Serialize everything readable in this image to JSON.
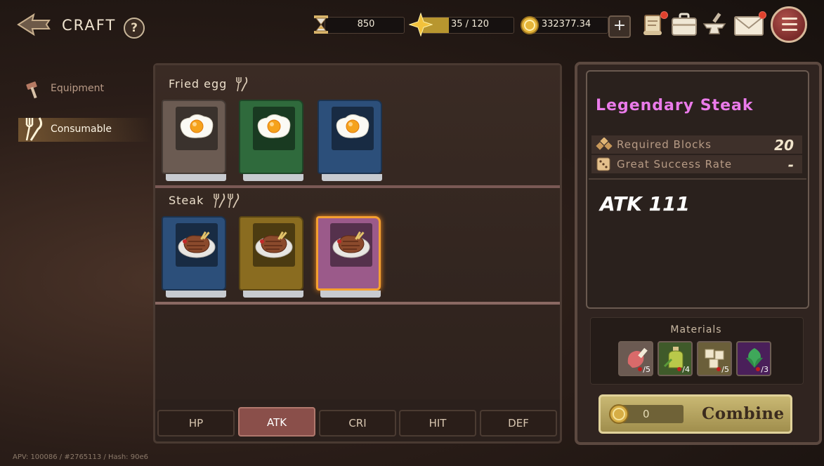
{
  "header": {
    "title": "CRAFT",
    "help_label": "?",
    "hourglass_value": "850",
    "energy_value": "35 / 120",
    "energy_fill": 0.29,
    "gold_value": "332377.34",
    "plus_label": "+"
  },
  "nav": {
    "items": [
      {
        "label": "Equipment",
        "icon": "hammer-icon",
        "active": false
      },
      {
        "label": "Consumable",
        "icon": "fork-knife-icon",
        "active": true
      }
    ]
  },
  "recipes": {
    "sections": [
      {
        "title": "Fried egg",
        "items": [
          {
            "name": "fried-egg",
            "rarity": "common",
            "cover": "#6b5b52"
          },
          {
            "name": "fried-egg",
            "rarity": "uncommon",
            "cover": "#2f6a3c"
          },
          {
            "name": "fried-egg",
            "rarity": "rare",
            "cover": "#2c4f7a"
          }
        ]
      },
      {
        "title": "Steak",
        "items": [
          {
            "name": "steak",
            "rarity": "rare",
            "cover": "#2c4f7a"
          },
          {
            "name": "steak",
            "rarity": "epic",
            "cover": "#8a6c20"
          },
          {
            "name": "steak",
            "rarity": "legendary",
            "cover": "#9b5a8a",
            "selected": true
          }
        ]
      }
    ]
  },
  "tabs": [
    {
      "label": "HP",
      "active": false
    },
    {
      "label": "ATK",
      "active": true
    },
    {
      "label": "CRI",
      "active": false
    },
    {
      "label": "HIT",
      "active": false
    },
    {
      "label": "DEF",
      "active": false
    }
  ],
  "detail": {
    "name": "Legendary Steak",
    "required_blocks_label": "Required Blocks",
    "required_blocks_value": "20",
    "great_success_label": "Great Success Rate",
    "great_success_value": "-",
    "effect": "ATK 111",
    "materials_title": "Materials",
    "materials": [
      {
        "icon": "meat-icon",
        "count": "/5",
        "bg": "#6b5a52"
      },
      {
        "icon": "oil-bottle-icon",
        "count": "/4",
        "bg": "#3f5a2a"
      },
      {
        "icon": "tofu-icon",
        "count": "/5",
        "bg": "#6b5f3a"
      },
      {
        "icon": "herb-icon",
        "count": "/3",
        "bg": "#4a1f5a"
      }
    ],
    "combine_cost": "0",
    "combine_label": "Combine"
  },
  "footer": "APV: 100086 / #2765113 / Hash: 90e6",
  "colors": {
    "legendary": "#ea7bea",
    "active_tab": "#8a4f4a",
    "combine_gold": "#c9b873"
  }
}
